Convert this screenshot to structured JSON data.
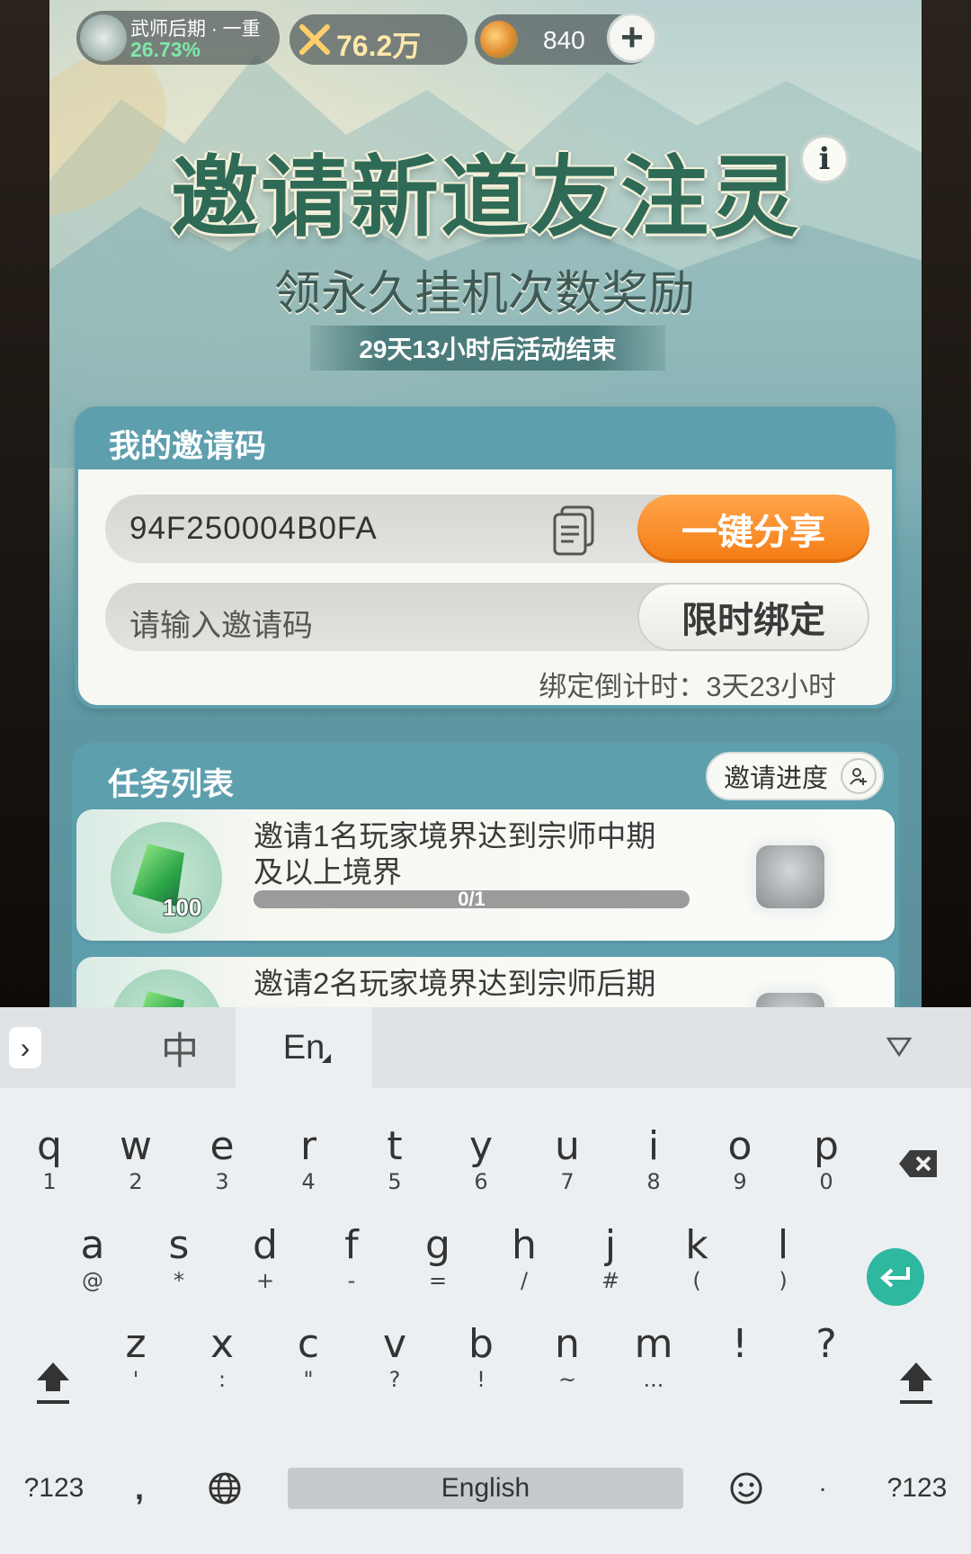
{
  "status_bar": {
    "realm_name": "武师后期 · 一重",
    "realm_percent": "26.73%",
    "combat_power": "76.2万",
    "currency_amount": "840",
    "add_currency_icon": "plus-icon"
  },
  "event": {
    "title": "邀请新道友注灵",
    "subtitle": "领永久挂机次数奖励",
    "countdown": "29天13小时后活动结束",
    "info_icon": "info-icon"
  },
  "invite_panel": {
    "title": "我的邀请码",
    "my_code": "94F250004B0FA",
    "share_label": "一键分享",
    "input_placeholder": "请输入邀请码",
    "bind_label": "限时绑定",
    "bind_countdown": "绑定倒计时：3天23小时"
  },
  "task_panel": {
    "title": "任务列表",
    "progress_button": "邀请进度",
    "tasks": [
      {
        "text": "邀请1名玩家境界达到宗师中期及以上境界",
        "reward_qty": "100",
        "progress": "0/1",
        "progress_fraction": 0
      },
      {
        "text": "邀请2名玩家境界达到宗师后期",
        "reward_qty": "",
        "progress": "",
        "progress_fraction": 0
      }
    ]
  },
  "keyboard": {
    "tab_zh": "中",
    "tab_en": "En",
    "rows": [
      [
        {
          "k": "q",
          "s": "1"
        },
        {
          "k": "w",
          "s": "2"
        },
        {
          "k": "e",
          "s": "3"
        },
        {
          "k": "r",
          "s": "4"
        },
        {
          "k": "t",
          "s": "5"
        },
        {
          "k": "y",
          "s": "6"
        },
        {
          "k": "u",
          "s": "7"
        },
        {
          "k": "i",
          "s": "8"
        },
        {
          "k": "o",
          "s": "9"
        },
        {
          "k": "p",
          "s": "0"
        }
      ],
      [
        {
          "k": "a",
          "s": "@"
        },
        {
          "k": "s",
          "s": "*"
        },
        {
          "k": "d",
          "s": "+"
        },
        {
          "k": "f",
          "s": "-"
        },
        {
          "k": "g",
          "s": "="
        },
        {
          "k": "h",
          "s": "/"
        },
        {
          "k": "j",
          "s": "#"
        },
        {
          "k": "k",
          "s": "("
        },
        {
          "k": "l",
          "s": ")"
        }
      ],
      [
        {
          "k": "z",
          "s": "'"
        },
        {
          "k": "x",
          "s": ":"
        },
        {
          "k": "c",
          "s": "\""
        },
        {
          "k": "v",
          "s": "?"
        },
        {
          "k": "b",
          "s": "!"
        },
        {
          "k": "n",
          "s": "~"
        },
        {
          "k": "m",
          "s": "..."
        },
        {
          "k": "!",
          "s": ""
        },
        {
          "k": "?",
          "s": ""
        }
      ]
    ],
    "bottom": {
      "left_symbols": "?123",
      "comma": ",",
      "space": "English",
      "period": "·",
      "right_symbols": "?123"
    },
    "colors": {
      "enter_accent": "#2fb8a0",
      "share_orange": "#f47c14"
    }
  }
}
